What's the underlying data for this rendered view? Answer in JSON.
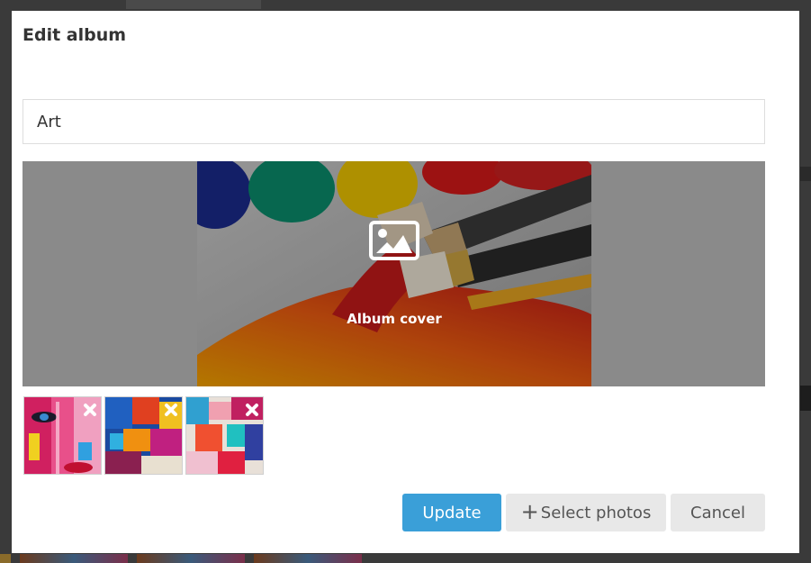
{
  "dialog": {
    "title": "Edit album"
  },
  "album": {
    "name_value": "Art"
  },
  "cover": {
    "label": "Album cover",
    "icon": "image-icon"
  },
  "thumbnails": [
    {
      "name": "face-painting",
      "remove_icon": "close-icon"
    },
    {
      "name": "abstract-blue-orange",
      "remove_icon": "close-icon"
    },
    {
      "name": "abstract-splash",
      "remove_icon": "close-icon"
    }
  ],
  "buttons": {
    "update": "Update",
    "select_photos": "Select photos",
    "select_photos_icon": "plus-icon",
    "cancel": "Cancel"
  },
  "colors": {
    "primary": "#3a9fd8",
    "secondary": "#e8e8e8"
  }
}
